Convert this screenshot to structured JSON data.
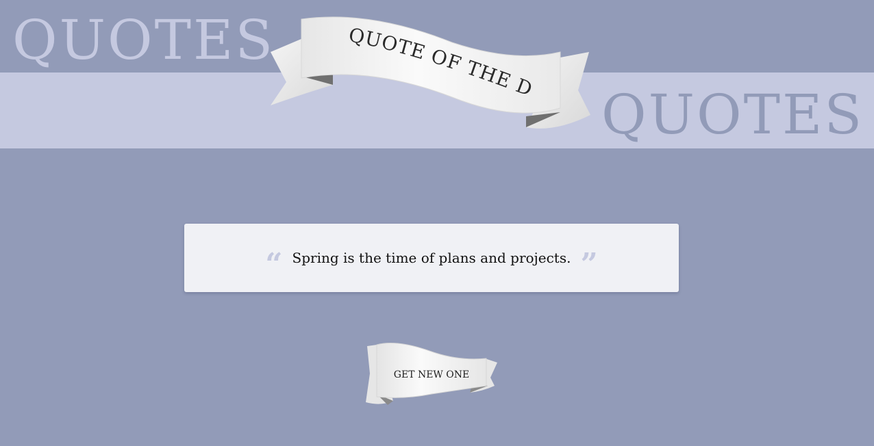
{
  "background": {
    "word_top": "QUOTES",
    "word_bottom": "QUOTES"
  },
  "banner": {
    "title": "QUOTE OF THE DAY"
  },
  "quote": {
    "text": "Spring is the time of plans and projects.",
    "open_mark_icon": "left-double-quote-icon",
    "close_mark_icon": "right-double-quote-icon"
  },
  "actions": {
    "new_quote_label": "GET NEW ONE"
  },
  "colors": {
    "page_background": "#929bb8",
    "band": "#c5c9e0",
    "card": "#f0f1f5",
    "quote_marks": "#c5c9e0",
    "ribbon": "#f2f2f2"
  }
}
